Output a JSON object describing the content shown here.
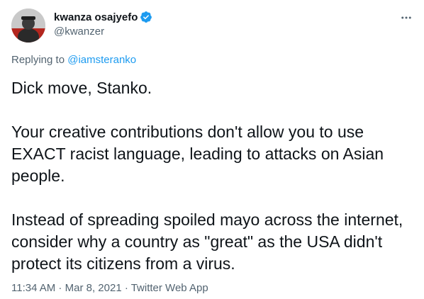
{
  "tweet": {
    "author": {
      "display_name": "kwanza osajyefo",
      "handle": "@kwanzer",
      "verified": true
    },
    "replying": {
      "prefix": "Replying to ",
      "mention": "@iamsteranko"
    },
    "body_lines": [
      "Dick move, Stanko.",
      "",
      "Your creative contributions don't allow you to use",
      "EXACT racist language, leading to attacks on Asian",
      "people.",
      "",
      "Instead of spreading spoiled mayo across the internet,",
      "consider why a country as \"great\" as the USA didn't",
      "protect its citizens from a virus."
    ],
    "meta": {
      "time": "11:34 AM",
      "separator": " · ",
      "date": "Mar 8, 2021",
      "source": "Twitter Web App"
    }
  },
  "icons": {
    "avatar": "avatar-image",
    "verified": "verified-badge-icon",
    "more": "more-options-icon"
  },
  "colors": {
    "primary_text": "#0f1419",
    "secondary_text": "#536471",
    "accent": "#1d9bf0"
  }
}
